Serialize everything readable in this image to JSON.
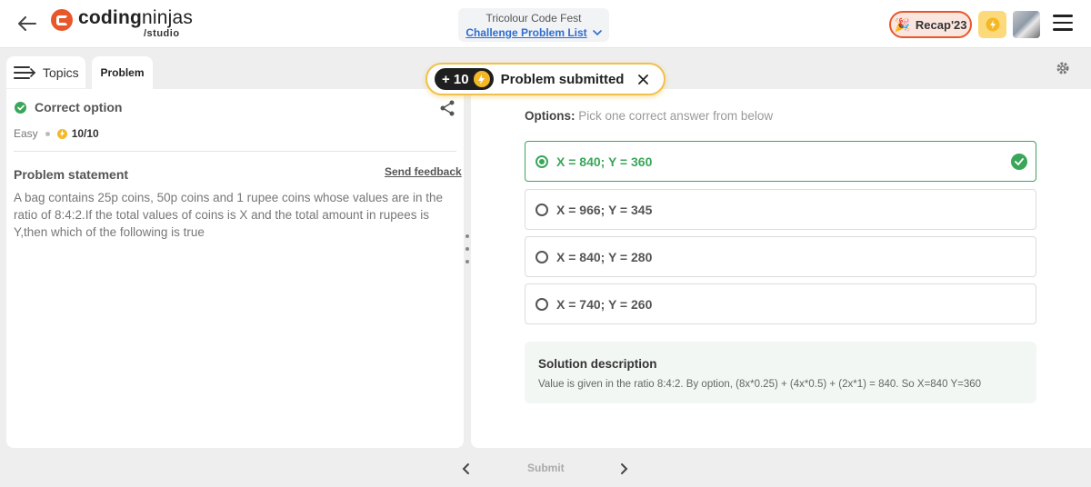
{
  "header": {
    "brand_name_light": "coding",
    "brand_name_bold": "ninjas",
    "brand_sub": "/studio",
    "event_title": "Tricolour Code Fest",
    "event_link": "Challenge Problem List",
    "recap_label": "Recap'23"
  },
  "tabs": {
    "topics_label": "Topics",
    "problem_label": "Problem"
  },
  "problem": {
    "status": "Correct option",
    "difficulty": "Easy",
    "score": "10/10",
    "statement_title": "Problem statement",
    "feedback_label": "Send feedback",
    "statement": "A bag contains 25p coins, 50p coins and 1 rupee coins whose values are in the ratio of 8:4:2.If the total values of coins is X and the total amount in rupees is Y,then which of the following is true"
  },
  "options": {
    "heading_label": "Options:",
    "heading_hint": "Pick one correct answer from below",
    "items": [
      {
        "label": "X = 840; Y = 360",
        "correct": true
      },
      {
        "label": "X = 966; Y = 345",
        "correct": false
      },
      {
        "label": "X = 840; Y = 280",
        "correct": false
      },
      {
        "label": "X = 740; Y = 260",
        "correct": false
      }
    ]
  },
  "solution": {
    "title": "Solution description",
    "body": "Value is given in the ratio 8:4:2. By option, (8x*0.25) + (4x*0.5) + (2x*1) = 840. So X=840 Y=360"
  },
  "toast": {
    "points": "+ 10",
    "message": "Problem submitted"
  },
  "footer": {
    "submit_label": "Submit"
  },
  "colors": {
    "accent_green": "#3aa65a",
    "brand_orange": "#e8572a",
    "link_blue": "#2f6dd4",
    "coin_yellow": "#f4b826"
  },
  "icons": [
    "back-arrow-icon",
    "chevron-down-icon",
    "bolt-icon",
    "menu-icon",
    "topics-icon",
    "settings-icon",
    "check-icon",
    "share-icon",
    "close-icon",
    "chevron-left-icon",
    "chevron-right-icon"
  ]
}
